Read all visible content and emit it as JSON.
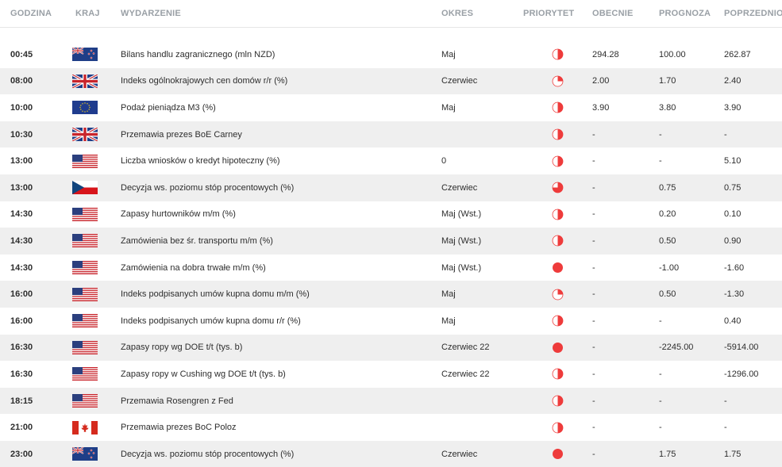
{
  "headers": {
    "time": "GODZINA",
    "country": "KRAJ",
    "event": "WYDARZENIE",
    "period": "OKRES",
    "priority": "PRIORYTET",
    "actual": "OBECNIE",
    "forecast": "PROGNOZA",
    "previous": "POPRZEDNIO"
  },
  "colors": {
    "priority_red": "#ee3b3b",
    "alt_row": "#efefef",
    "header_text": "#9aa0a6"
  },
  "rows": [
    {
      "time": "00:45",
      "flag": "nz",
      "event": "Bilans handlu zagranicznego (mln NZD)",
      "period": "Maj",
      "priority": "medium",
      "actual": "294.28",
      "forecast": "100.00",
      "previous": "262.87"
    },
    {
      "time": "08:00",
      "flag": "gb",
      "event": "Indeks ogólnokrajowych cen domów r/r (%)",
      "period": "Czerwiec",
      "priority": "low",
      "actual": "2.00",
      "forecast": "1.70",
      "previous": "2.40"
    },
    {
      "time": "10:00",
      "flag": "eu",
      "event": "Podaż pieniądza M3 (%)",
      "period": "Maj",
      "priority": "medium",
      "actual": "3.90",
      "forecast": "3.80",
      "previous": "3.90"
    },
    {
      "time": "10:30",
      "flag": "gb",
      "event": "Przemawia prezes BoE Carney",
      "period": "",
      "priority": "medium",
      "actual": "-",
      "forecast": "-",
      "previous": "-"
    },
    {
      "time": "13:00",
      "flag": "us",
      "event": "Liczba wniosków o kredyt hipoteczny (%)",
      "period": "0",
      "priority": "medium",
      "actual": "-",
      "forecast": "-",
      "previous": "5.10"
    },
    {
      "time": "13:00",
      "flag": "cz",
      "event": "Decyzja ws. poziomu stóp procentowych (%)",
      "period": "Czerwiec",
      "priority": "mediumhigh",
      "actual": "-",
      "forecast": "0.75",
      "previous": "0.75"
    },
    {
      "time": "14:30",
      "flag": "us",
      "event": "Zapasy hurtowników m/m (%)",
      "period": "Maj (Wst.)",
      "priority": "medium",
      "actual": "-",
      "forecast": "0.20",
      "previous": "0.10"
    },
    {
      "time": "14:30",
      "flag": "us",
      "event": "Zamówienia bez śr. transportu m/m (%)",
      "period": "Maj (Wst.)",
      "priority": "medium",
      "actual": "-",
      "forecast": "0.50",
      "previous": "0.90"
    },
    {
      "time": "14:30",
      "flag": "us",
      "event": "Zamówienia na dobra trwałe m/m (%)",
      "period": "Maj (Wst.)",
      "priority": "high",
      "actual": "-",
      "forecast": "-1.00",
      "previous": "-1.60"
    },
    {
      "time": "16:00",
      "flag": "us",
      "event": "Indeks podpisanych umów kupna domu m/m (%)",
      "period": "Maj",
      "priority": "low",
      "actual": "-",
      "forecast": "0.50",
      "previous": "-1.30"
    },
    {
      "time": "16:00",
      "flag": "us",
      "event": "Indeks podpisanych umów kupna domu r/r (%)",
      "period": "Maj",
      "priority": "medium",
      "actual": "-",
      "forecast": "-",
      "previous": "0.40"
    },
    {
      "time": "16:30",
      "flag": "us",
      "event": "Zapasy ropy wg DOE t/t (tys. b)",
      "period": "Czerwiec 22",
      "priority": "high",
      "actual": "-",
      "forecast": "-2245.00",
      "previous": "-5914.00"
    },
    {
      "time": "16:30",
      "flag": "us",
      "event": "Zapasy ropy w Cushing wg DOE t/t (tys. b)",
      "period": "Czerwiec 22",
      "priority": "medium",
      "actual": "-",
      "forecast": "-",
      "previous": "-1296.00"
    },
    {
      "time": "18:15",
      "flag": "us",
      "event": "Przemawia Rosengren z Fed",
      "period": "",
      "priority": "medium",
      "actual": "-",
      "forecast": "-",
      "previous": "-"
    },
    {
      "time": "21:00",
      "flag": "ca",
      "event": "Przemawia prezes BoC Poloz",
      "period": "",
      "priority": "medium",
      "actual": "-",
      "forecast": "-",
      "previous": "-"
    },
    {
      "time": "23:00",
      "flag": "nz",
      "event": "Decyzja ws. poziomu stóp procentowych (%)",
      "period": "Czerwiec",
      "priority": "high",
      "actual": "-",
      "forecast": "1.75",
      "previous": "1.75"
    }
  ]
}
